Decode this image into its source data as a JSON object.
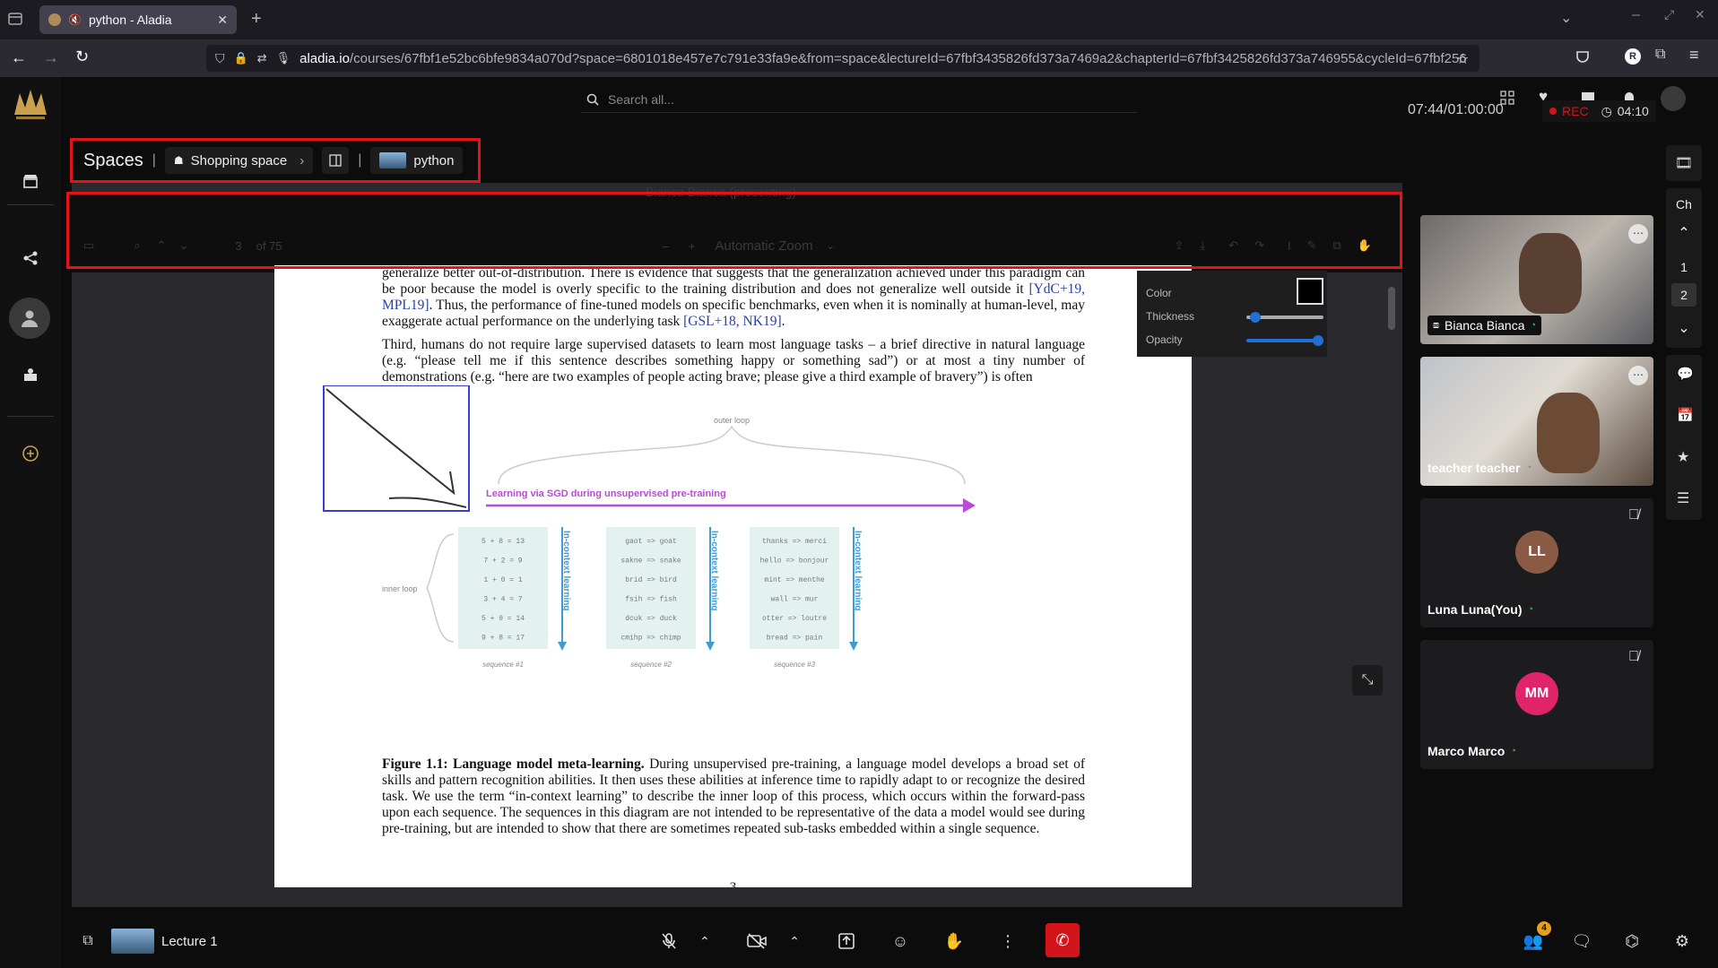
{
  "browser": {
    "tab_title": "python - Aladia",
    "url_host": "aladia.io",
    "url_path": "/courses/67fbf1e52bc6bfe9834a070d?space=6801018e457e7c791e33fa9e&from=space&lectureId=67fbf3435826fd373a7469a2&chapterId=67fbf3425826fd373a746955&cycleId=67fbf256"
  },
  "header": {
    "search_placeholder": "Search all..."
  },
  "breadcrumb": {
    "root": "Spaces",
    "space": "Shopping space",
    "course": "python"
  },
  "presenter": {
    "label": "Bianca Bianca (presenting)"
  },
  "pdf_toolbar": {
    "page": "3",
    "of_pages": "of 75",
    "zoom": "Automatic Zoom"
  },
  "draw_panel": {
    "color_label": "Color",
    "thickness_label": "Thickness",
    "opacity_label": "Opacity",
    "thickness_value": 0.05,
    "opacity_value": 1.0
  },
  "document": {
    "para1": "generalize better out-of-distribution. There is evidence that suggests that the generalization achieved under this paradigm can be poor because the model is overly specific to the training distribution and does not generalize well outside it",
    "para1_cite1": "[YdC+19, MPL19]",
    "para1_cont": ". Thus, the performance of fine-tuned models on specific benchmarks, even when it is nominally at human-level, may exaggerate actual performance on the underlying task ",
    "para1_cite2": "[GSL+18, NK19]",
    "para1_end": ".",
    "para2": "Third, humans do not require large supervised datasets to learn most language tasks – a brief directive in natural language (e.g. “please tell me if this sentence describes something happy or something sad”) or at most a tiny number of demonstrations (e.g. “here are two examples of people acting brave; please give a third example of bravery”) is often",
    "fig_outer_loop": "outer loop",
    "fig_arrow_label": "Learning via SGD during unsupervised pre-training",
    "fig_inner_loop": "inner loop",
    "fig_vertical": "In-context learning",
    "seq1": [
      "5 + 8 = 13",
      "7 + 2 = 9",
      "1 + 0 = 1",
      "3 + 4 = 7",
      "5 + 9 = 14",
      "9 + 8 = 17"
    ],
    "seq2": [
      "gaot => goat",
      "sakne => snake",
      "brid => bird",
      "fsih => fish",
      "dcuk => duck",
      "cmihp => chimp"
    ],
    "seq3": [
      "thanks => merci",
      "hello => bonjour",
      "mint => menthe",
      "wall => mur",
      "otter => loutre",
      "bread => pain"
    ],
    "seq_labels": [
      "sequence #1",
      "sequence #2",
      "sequence #3"
    ],
    "caption_bold": "Figure 1.1: Language model meta-learning.",
    "caption": " During unsupervised pre-training, a language model develops a broad set of skills and pattern recognition abilities. It then uses these abilities at inference time to rapidly adapt to or recognize the desired task. We use the term “in-context learning” to describe the inner loop of this process, which occurs within the forward-pass upon each sequence. The sequences in this diagram are not intended to be representative of the data a model would see during pre-training, but are intended to show that there are sometimes repeated sub-tasks embedded within a single sequence.",
    "page_number": "3"
  },
  "session": {
    "timer": "07:44/01:00:00",
    "rec_label": "REC",
    "rec_time": "04:10"
  },
  "participants": [
    {
      "name": "Bianca Bianca",
      "initials": ""
    },
    {
      "name": "teacher teacher",
      "initials": ""
    },
    {
      "name": "Luna Luna(You)",
      "initials": "LL"
    },
    {
      "name": "Marco Marco",
      "initials": "MM"
    }
  ],
  "chapters": {
    "label": "Ch",
    "items": [
      "1",
      "2"
    ]
  },
  "bottom": {
    "lecture_label": "Lecture 1",
    "people_count": "4"
  },
  "colors": {
    "accent_red": "#e0141b",
    "fig_purple": "#b94bd6",
    "fig_blue": "#3d9bd6",
    "avatar_ll": "#8a5a44",
    "avatar_mm": "#e0246a"
  }
}
